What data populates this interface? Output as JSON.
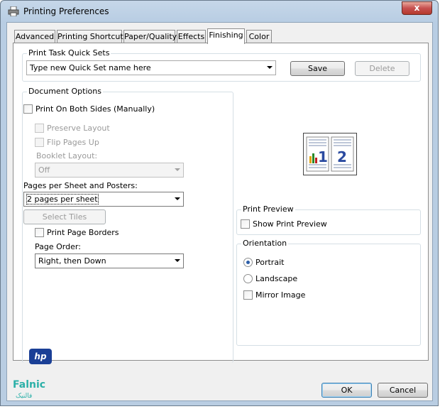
{
  "window": {
    "title": "Printing Preferences",
    "close_glyph": "x"
  },
  "tabs": [
    {
      "label": "Advanced",
      "active": false
    },
    {
      "label": "Printing Shortcuts",
      "active": false
    },
    {
      "label": "Paper/Quality",
      "active": false
    },
    {
      "label": "Effects",
      "active": false
    },
    {
      "label": "Finishing",
      "active": true
    },
    {
      "label": "Color",
      "active": false
    }
  ],
  "quick_sets": {
    "label": "Print Task Quick Sets",
    "value": "Type new Quick Set name here",
    "save_label": "Save",
    "delete_label": "Delete"
  },
  "document_options": {
    "label": "Document Options",
    "print_both_sides": "Print On Both Sides (Manually)",
    "preserve_layout": "Preserve Layout",
    "flip_pages_up": "Flip Pages Up",
    "booklet_layout_label": "Booklet Layout:",
    "booklet_layout_value": "Off",
    "pages_per_sheet_label": "Pages per Sheet and Posters:",
    "pages_per_sheet_value": "2 pages per sheet",
    "select_tiles_label": "Select Tiles",
    "print_page_borders": "Print Page Borders",
    "page_order_label": "Page Order:",
    "page_order_value": "Right, then Down"
  },
  "preview_image": {
    "page1": "1",
    "page2": "2"
  },
  "print_preview": {
    "label": "Print Preview",
    "show_print_preview": "Show Print Preview"
  },
  "orientation": {
    "label": "Orientation",
    "portrait": "Portrait",
    "landscape": "Landscape",
    "mirror_image": "Mirror Image",
    "selected": "Portrait"
  },
  "logo": {
    "hp": "hp"
  },
  "watermark": {
    "brand": "Falnic",
    "sub": "فالنیک"
  },
  "footer": {
    "ok_label": "OK",
    "cancel_label": "Cancel"
  },
  "colors": {
    "title_bar": "#b9cde2",
    "close_button": "#c75050",
    "radio_dot": "#2b5ea8",
    "hp_blue": "#1a3f96",
    "watermark": "#2bb0a8"
  }
}
